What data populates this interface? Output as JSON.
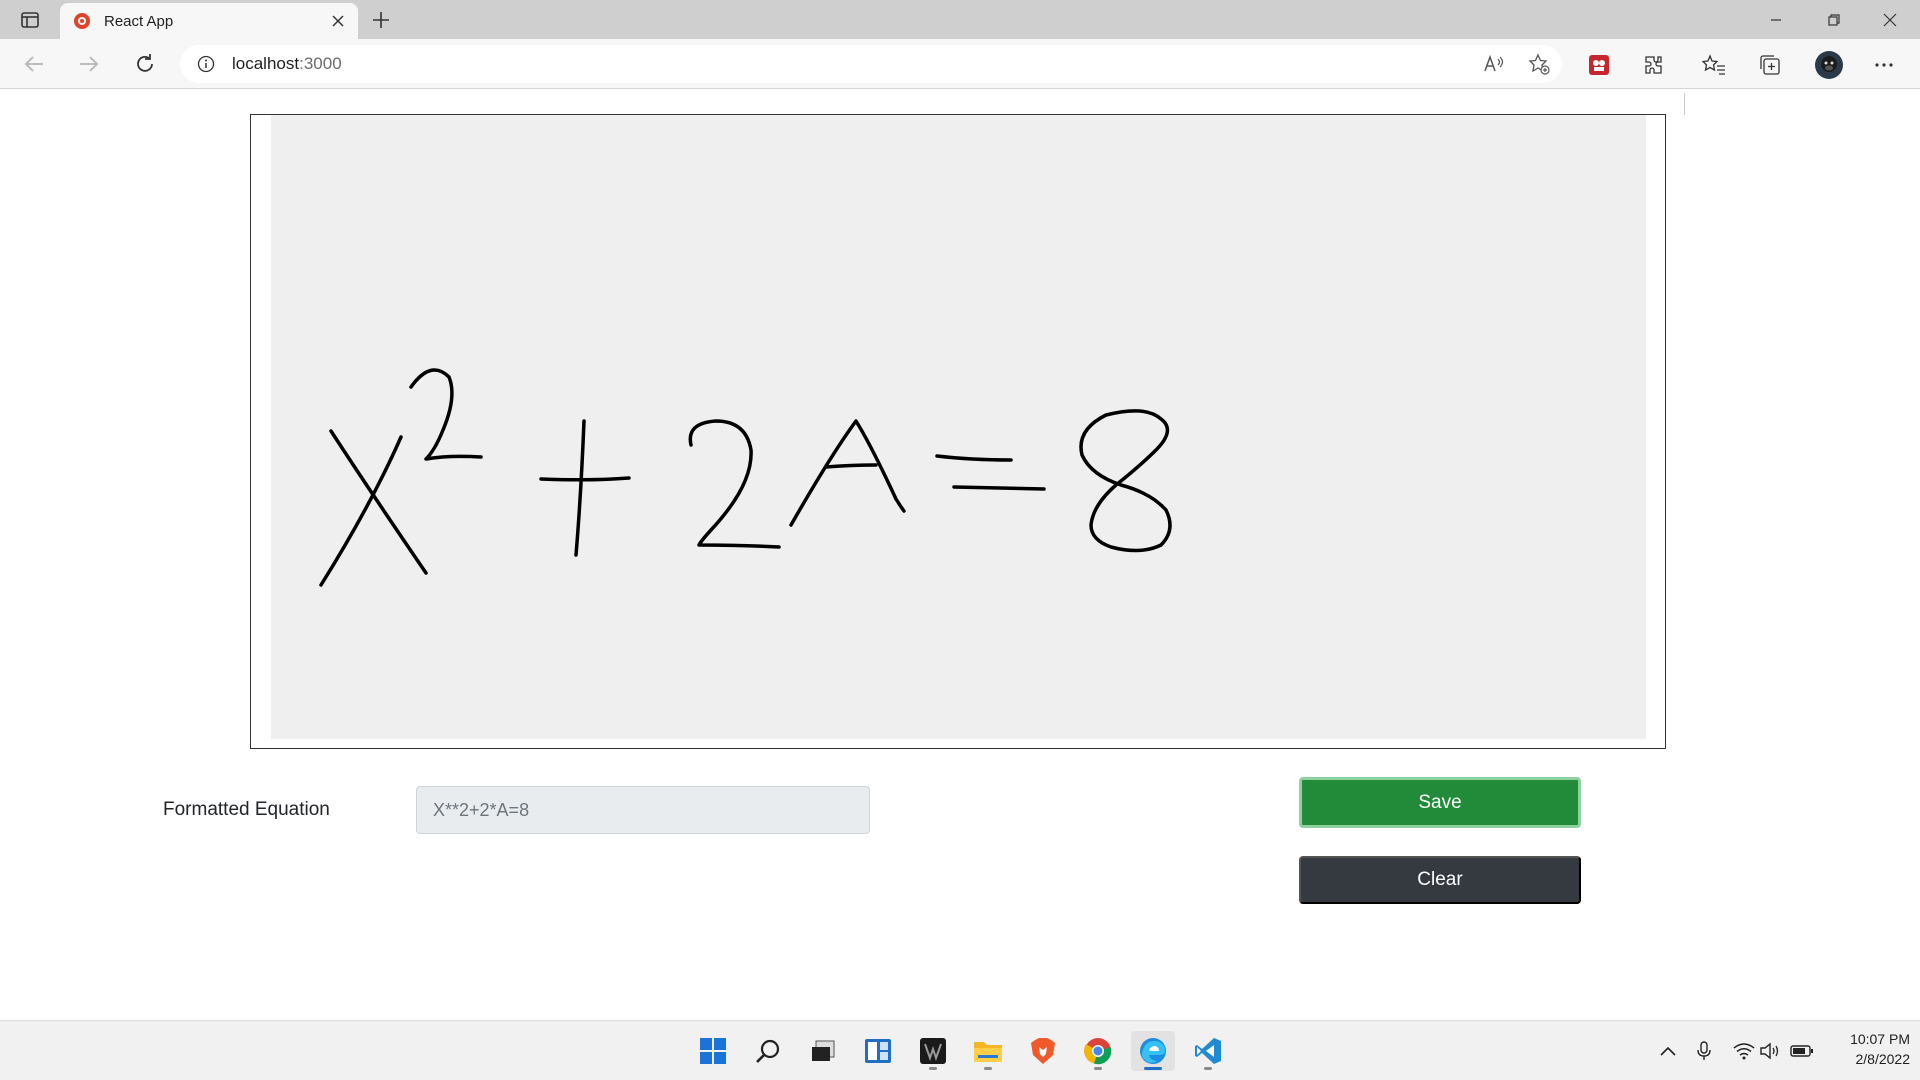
{
  "browser": {
    "tab_title": "React App",
    "url_host": "localhost",
    "url_port": ":3000",
    "icons": [
      "tab-actions-icon",
      "react-favicon-icon",
      "close-icon",
      "plus-icon",
      "minimize-icon",
      "restore-icon",
      "close-window-icon",
      "back-icon",
      "forward-icon",
      "refresh-icon",
      "info-icon",
      "read-aloud-icon",
      "add-favorite-icon",
      "extension-red-icon",
      "extensions-icon",
      "favorites-icon",
      "collections-icon",
      "profile-avatar-icon",
      "more-icon"
    ]
  },
  "canvas": {
    "handwriting_description": "X²+2A=8",
    "background_color": "#efefef",
    "ink_color": "#000000"
  },
  "form": {
    "label": "Formatted Equation",
    "equation_value": "X**2+2*A=8",
    "save_label": "Save",
    "clear_label": "Clear"
  },
  "colors": {
    "save_bg": "#228b3a",
    "clear_bg": "#343a40"
  },
  "taskbar": {
    "apps": [
      "windows-start-icon",
      "search-icon",
      "task-view-icon",
      "widgets-icon",
      "predator-app-icon",
      "file-explorer-icon",
      "brave-icon",
      "chrome-icon",
      "edge-icon",
      "vscode-icon"
    ],
    "tray": [
      "chevron-up-icon",
      "microphone-icon",
      "wifi-icon",
      "volume-icon",
      "battery-icon"
    ],
    "time": "10:07 PM",
    "date": "2/8/2022"
  }
}
